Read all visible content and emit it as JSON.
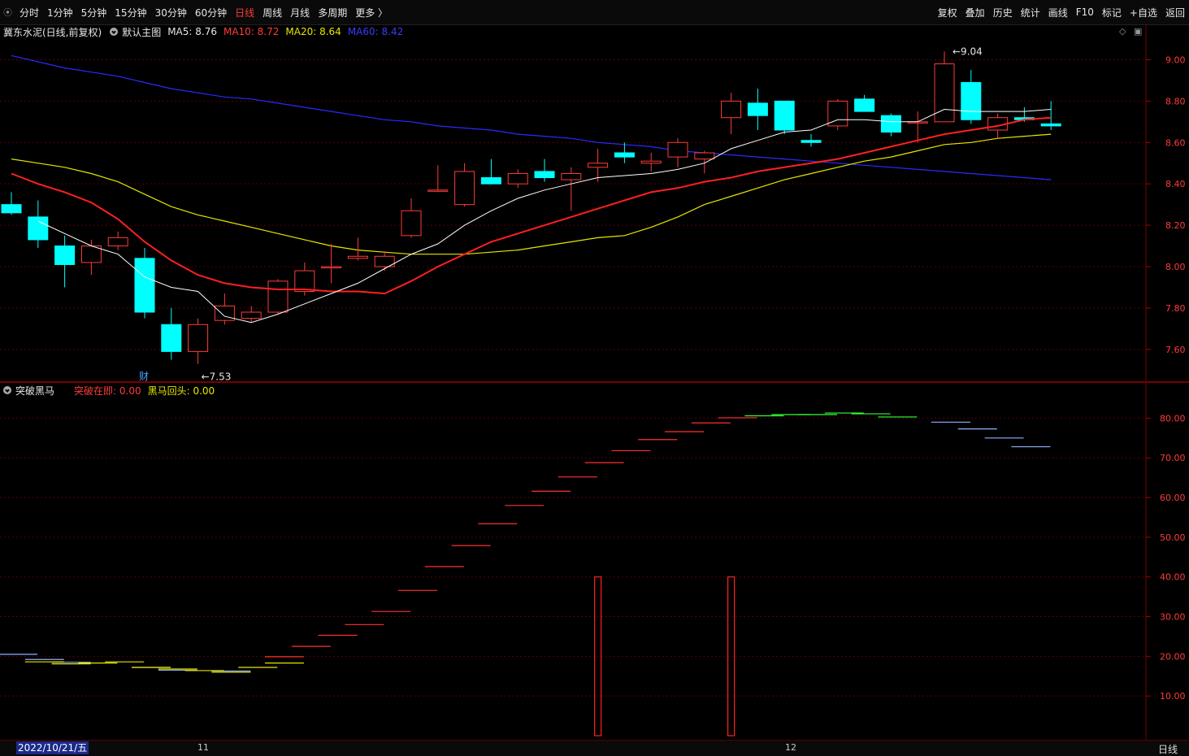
{
  "toolbar": {
    "left": [
      "分时",
      "1分钟",
      "5分钟",
      "15分钟",
      "30分钟",
      "60分钟",
      "日线",
      "周线",
      "月线",
      "多周期",
      "更多 〉"
    ],
    "active": "日线",
    "right": [
      "复权",
      "叠加",
      "历史",
      "统计",
      "画线",
      "F10",
      "标记",
      "+自选",
      "返回"
    ]
  },
  "main_header": {
    "stock": "冀东水泥(日线,前复权)",
    "template": "默认主图",
    "ma5": "MA5: 8.76",
    "ma10": "MA10: 8.72",
    "ma20": "MA20: 8.64",
    "ma60": "MA60: 8.42"
  },
  "sub_header": {
    "name": "突破黑马",
    "v1": "突破在即: 0.00",
    "v2": "黑马回头: 0.00"
  },
  "annotations": {
    "high": "9.04",
    "low": "7.53",
    "cai": "财"
  },
  "colors": {
    "up": "#ff3b3b",
    "down": "#00ffff",
    "ma5": "#ffffff",
    "ma10": "#ff2020",
    "ma20": "#e6e600",
    "ma60": "#2a2aff",
    "grid": "#5a0000"
  },
  "status": {
    "date": "2022/10/21/五",
    "months": [
      "11",
      "12"
    ],
    "period": "日线"
  },
  "chart_data": [
    {
      "type": "candlestick",
      "title": "冀东水泥(日线,前复权)",
      "ylim": [
        7.45,
        9.1
      ],
      "yticks": [
        "9.00",
        "8.80",
        "8.60",
        "8.40",
        "8.20",
        "8.00",
        "7.80",
        "7.60"
      ],
      "candles": [
        {
          "o": 8.3,
          "h": 8.36,
          "l": 8.25,
          "c": 8.26
        },
        {
          "o": 8.24,
          "h": 8.32,
          "l": 8.09,
          "c": 8.13
        },
        {
          "o": 8.1,
          "h": 8.15,
          "l": 7.9,
          "c": 8.01
        },
        {
          "o": 8.02,
          "h": 8.13,
          "l": 7.96,
          "c": 8.1
        },
        {
          "o": 8.1,
          "h": 8.17,
          "l": 8.08,
          "c": 8.14
        },
        {
          "o": 8.04,
          "h": 8.09,
          "l": 7.75,
          "c": 7.78
        },
        {
          "o": 7.72,
          "h": 7.8,
          "l": 7.55,
          "c": 7.59
        },
        {
          "o": 7.59,
          "h": 7.75,
          "l": 7.53,
          "c": 7.72
        },
        {
          "o": 7.74,
          "h": 7.87,
          "l": 7.72,
          "c": 7.81
        },
        {
          "o": 7.75,
          "h": 7.81,
          "l": 7.73,
          "c": 7.78
        },
        {
          "o": 7.78,
          "h": 7.94,
          "l": 7.77,
          "c": 7.93
        },
        {
          "o": 7.88,
          "h": 8.02,
          "l": 7.86,
          "c": 7.98
        },
        {
          "o": 8.0,
          "h": 8.11,
          "l": 7.92,
          "c": 8.0
        },
        {
          "o": 8.04,
          "h": 8.14,
          "l": 8.03,
          "c": 8.05
        },
        {
          "o": 8.0,
          "h": 8.07,
          "l": 7.98,
          "c": 8.05
        },
        {
          "o": 8.15,
          "h": 8.33,
          "l": 8.14,
          "c": 8.27
        },
        {
          "o": 8.37,
          "h": 8.49,
          "l": 8.36,
          "c": 8.37
        },
        {
          "o": 8.3,
          "h": 8.5,
          "l": 8.29,
          "c": 8.46
        },
        {
          "o": 8.43,
          "h": 8.52,
          "l": 8.4,
          "c": 8.4
        },
        {
          "o": 8.4,
          "h": 8.47,
          "l": 8.38,
          "c": 8.45
        },
        {
          "o": 8.46,
          "h": 8.52,
          "l": 8.41,
          "c": 8.43
        },
        {
          "o": 8.42,
          "h": 8.48,
          "l": 8.27,
          "c": 8.45
        },
        {
          "o": 8.48,
          "h": 8.57,
          "l": 8.41,
          "c": 8.5
        },
        {
          "o": 8.55,
          "h": 8.6,
          "l": 8.5,
          "c": 8.53
        },
        {
          "o": 8.5,
          "h": 8.55,
          "l": 8.46,
          "c": 8.51
        },
        {
          "o": 8.53,
          "h": 8.62,
          "l": 8.48,
          "c": 8.6
        },
        {
          "o": 8.52,
          "h": 8.56,
          "l": 8.45,
          "c": 8.55
        },
        {
          "o": 8.72,
          "h": 8.84,
          "l": 8.64,
          "c": 8.8
        },
        {
          "o": 8.79,
          "h": 8.86,
          "l": 8.66,
          "c": 8.73
        },
        {
          "o": 8.8,
          "h": 8.8,
          "l": 8.64,
          "c": 8.66
        },
        {
          "o": 8.61,
          "h": 8.64,
          "l": 8.58,
          "c": 8.6
        },
        {
          "o": 8.68,
          "h": 8.81,
          "l": 8.66,
          "c": 8.8
        },
        {
          "o": 8.81,
          "h": 8.83,
          "l": 8.75,
          "c": 8.75
        },
        {
          "o": 8.73,
          "h": 8.74,
          "l": 8.63,
          "c": 8.65
        },
        {
          "o": 8.7,
          "h": 8.75,
          "l": 8.6,
          "c": 8.7
        },
        {
          "o": 8.7,
          "h": 9.04,
          "l": 8.7,
          "c": 8.98
        },
        {
          "o": 8.89,
          "h": 8.95,
          "l": 8.69,
          "c": 8.71
        },
        {
          "o": 8.66,
          "h": 8.74,
          "l": 8.62,
          "c": 8.72
        },
        {
          "o": 8.72,
          "h": 8.77,
          "l": 8.7,
          "c": 8.71
        },
        {
          "o": 8.69,
          "h": 8.8,
          "l": 8.66,
          "c": 8.68
        }
      ],
      "ma5": [
        null,
        8.22,
        8.16,
        8.1,
        8.06,
        7.95,
        7.9,
        7.88,
        7.76,
        7.73,
        7.77,
        7.82,
        7.87,
        7.92,
        7.99,
        8.06,
        8.11,
        8.2,
        8.27,
        8.33,
        8.37,
        8.4,
        8.43,
        8.44,
        8.45,
        8.47,
        8.5,
        8.57,
        8.61,
        8.65,
        8.66,
        8.71,
        8.71,
        8.7,
        8.7,
        8.76,
        8.75,
        8.75,
        8.75,
        8.76
      ],
      "ma10": [
        8.45,
        8.4,
        8.36,
        8.31,
        8.23,
        8.12,
        8.03,
        7.96,
        7.92,
        7.9,
        7.89,
        7.89,
        7.88,
        7.88,
        7.87,
        7.93,
        8.0,
        8.06,
        8.12,
        8.16,
        8.2,
        8.24,
        8.28,
        8.32,
        8.36,
        8.38,
        8.41,
        8.43,
        8.46,
        8.48,
        8.5,
        8.52,
        8.55,
        8.58,
        8.61,
        8.64,
        8.66,
        8.68,
        8.71,
        8.72
      ],
      "ma20": [
        8.52,
        8.5,
        8.48,
        8.45,
        8.41,
        8.35,
        8.29,
        8.25,
        8.22,
        8.19,
        8.16,
        8.13,
        8.1,
        8.08,
        8.07,
        8.06,
        8.06,
        8.06,
        8.07,
        8.08,
        8.1,
        8.12,
        8.14,
        8.15,
        8.19,
        8.24,
        8.3,
        8.34,
        8.38,
        8.42,
        8.45,
        8.48,
        8.51,
        8.53,
        8.56,
        8.59,
        8.6,
        8.62,
        8.63,
        8.64
      ],
      "ma60": [
        9.02,
        8.99,
        8.96,
        8.94,
        8.92,
        8.89,
        8.86,
        8.84,
        8.82,
        8.81,
        8.79,
        8.77,
        8.75,
        8.73,
        8.71,
        8.7,
        8.68,
        8.67,
        8.66,
        8.64,
        8.63,
        8.62,
        8.6,
        8.59,
        8.58,
        8.56,
        8.55,
        8.54,
        8.53,
        8.52,
        8.51,
        8.5,
        8.49,
        8.48,
        8.47,
        8.46,
        8.45,
        8.44,
        8.43,
        8.42
      ]
    },
    {
      "type": "step-line",
      "title": "突破黑马",
      "ylim": [
        0,
        85
      ],
      "yticks": [
        "80.00",
        "70.00",
        "60.00",
        "50.00",
        "40.00",
        "30.00",
        "20.00",
        "10.00"
      ],
      "blue_steps": [
        {
          "x": 0,
          "y": 20.5
        },
        {
          "x": 1,
          "y": 19.2
        },
        {
          "x": 2,
          "y": 18.5
        },
        {
          "x": 5,
          "y": 17.2
        },
        {
          "x": 6,
          "y": 16.5
        },
        {
          "x": 8,
          "y": 16.3
        }
      ],
      "yellow_steps": [
        {
          "x": 1,
          "y": 18.6
        },
        {
          "x": 2,
          "y": 18.1
        },
        {
          "x": 3,
          "y": 18.3
        },
        {
          "x": 4,
          "y": 18.6
        },
        {
          "x": 5,
          "y": 17.2
        },
        {
          "x": 6,
          "y": 16.8
        },
        {
          "x": 7,
          "y": 16.4
        },
        {
          "x": 8,
          "y": 16.0
        },
        {
          "x": 9,
          "y": 17.2
        },
        {
          "x": 10,
          "y": 18.3
        }
      ],
      "red_steps": [
        {
          "x": 10,
          "y": 19.9
        },
        {
          "x": 11,
          "y": 22.5
        },
        {
          "x": 12,
          "y": 25.3
        },
        {
          "x": 13,
          "y": 28.0
        },
        {
          "x": 14,
          "y": 31.3
        },
        {
          "x": 15,
          "y": 36.6
        },
        {
          "x": 16,
          "y": 42.6
        },
        {
          "x": 17,
          "y": 47.9
        },
        {
          "x": 18,
          "y": 53.4
        },
        {
          "x": 19,
          "y": 58.0
        },
        {
          "x": 20,
          "y": 61.6
        },
        {
          "x": 21,
          "y": 65.2
        },
        {
          "x": 22,
          "y": 68.8
        },
        {
          "x": 23,
          "y": 71.8
        },
        {
          "x": 24,
          "y": 74.6
        },
        {
          "x": 25,
          "y": 76.6
        },
        {
          "x": 26,
          "y": 78.8
        },
        {
          "x": 27,
          "y": 80.1
        }
      ],
      "green_steps": [
        {
          "x": 28,
          "y": 80.6
        },
        {
          "x": 29,
          "y": 80.9
        },
        {
          "x": 30,
          "y": 80.9
        },
        {
          "x": 31,
          "y": 81.3
        },
        {
          "x": 32,
          "y": 81.1
        },
        {
          "x": 33,
          "y": 80.3
        }
      ],
      "blue_steps_2": [
        {
          "x": 35,
          "y": 79.0
        },
        {
          "x": 36,
          "y": 77.3
        },
        {
          "x": 37,
          "y": 75.0
        },
        {
          "x": 38,
          "y": 72.8
        }
      ],
      "bars": [
        {
          "x": 22,
          "y": 40
        },
        {
          "x": 27,
          "y": 40
        }
      ]
    }
  ]
}
